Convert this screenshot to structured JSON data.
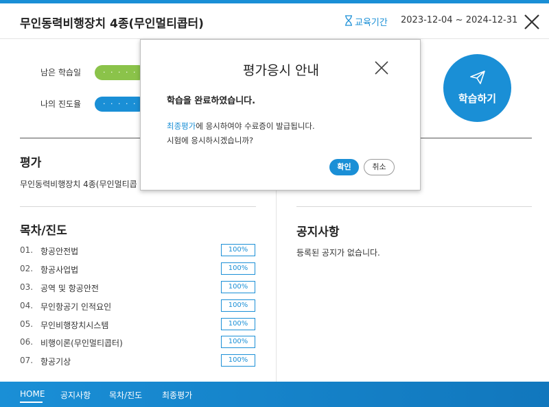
{
  "header": {
    "course_title": "무인동력비행장치 4종(무인멀티콥터)",
    "period_label": "교육기간",
    "period_dates": "2023-12-04 ~ 2024-12-31",
    "period_icon": "hourglass-icon",
    "close_icon": "close-icon"
  },
  "status": {
    "remaining_label": "남은 학습일",
    "progress_label": "나의 진도율",
    "bar_dots": "· · · · · · · ·",
    "study_button": "학습하기",
    "study_icon": "paper-plane-icon"
  },
  "evaluation": {
    "title": "평가",
    "course_line": "무인동력비행장치 4종(무인멀티콥"
  },
  "toc": {
    "title": "목차/진도",
    "items": [
      {
        "num": "01.",
        "label": "항공안전법",
        "progress": "100%"
      },
      {
        "num": "02.",
        "label": "항공사업법",
        "progress": "100%"
      },
      {
        "num": "03.",
        "label": "공역 및 항공안전",
        "progress": "100%"
      },
      {
        "num": "04.",
        "label": "무인항공기 인적요인",
        "progress": "100%"
      },
      {
        "num": "05.",
        "label": "무인비행장치시스템",
        "progress": "100%"
      },
      {
        "num": "06.",
        "label": "비행이론(무인멀티콥터)",
        "progress": "100%"
      },
      {
        "num": "07.",
        "label": "항공기상",
        "progress": "100%"
      }
    ]
  },
  "notice": {
    "title": "공지사항",
    "empty": "등록된 공지가 없습니다."
  },
  "bottom_nav": {
    "items": [
      "HOME",
      "공지사항",
      "목차/진도",
      "최종평가"
    ],
    "active": "HOME"
  },
  "modal": {
    "title": "평가응시 안내",
    "message": "학습을 완료하였습니다.",
    "line1_link": "최종평가",
    "line1_rest": "에 응시하여야 수료증이 발급됩니다.",
    "line2": "시험에 응시하시겠습니까?",
    "ok": "확인",
    "cancel": "취소"
  },
  "colors": {
    "accent": "#1a8fd6",
    "green": "#8bc34a"
  }
}
